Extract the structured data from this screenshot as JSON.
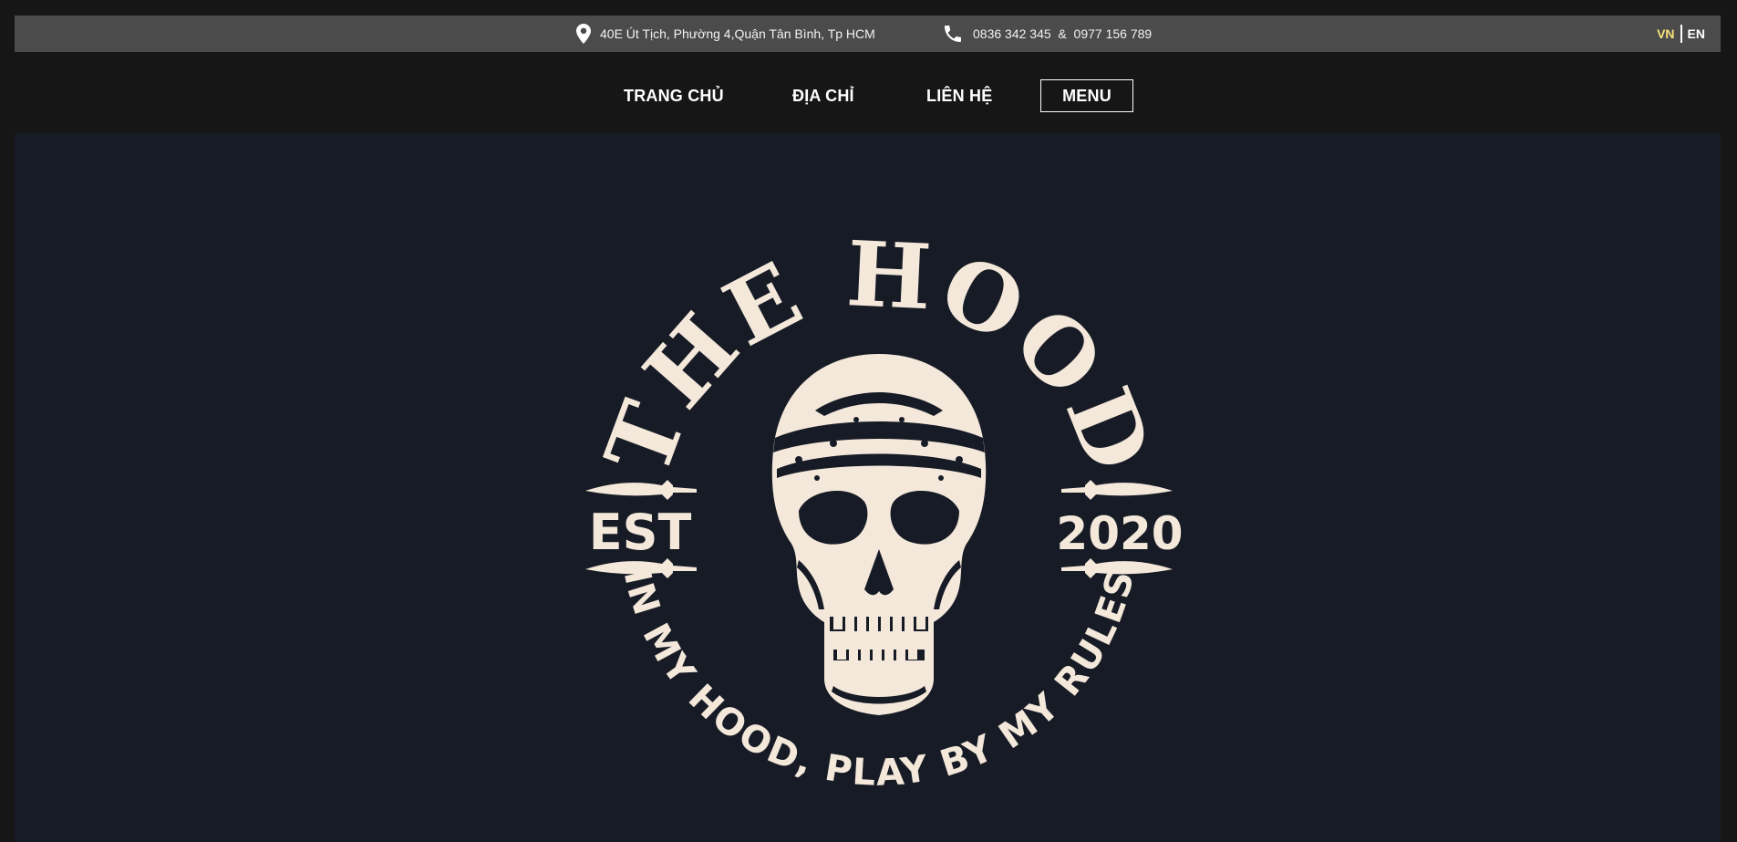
{
  "topbar": {
    "address": "40E Út Tịch, Phường 4,Quận Tân Bình, Tp HCM",
    "address_icon": "map-pin-icon",
    "phone": "0836 342 345  &  0977 156 789",
    "phone_icon": "phone-icon",
    "lang_vn": "VN",
    "lang_en": "EN"
  },
  "nav": {
    "home": "TRANG CHỦ",
    "address": "ĐỊA CHỈ",
    "contact": "LIÊN HỆ",
    "menu": "MENU"
  },
  "hero": {
    "logo": {
      "title": "THE HOOD",
      "est": "EST",
      "year": "2020",
      "slogan": "IN MY HOOD, PLAY BY MY RULES"
    }
  },
  "colors": {
    "page_bg": "#161616",
    "topbar_bg": "#4b4b4b",
    "hero_bg": "#171b26",
    "logo_cream": "#f3e8da",
    "lang_active": "#f5e27a"
  }
}
